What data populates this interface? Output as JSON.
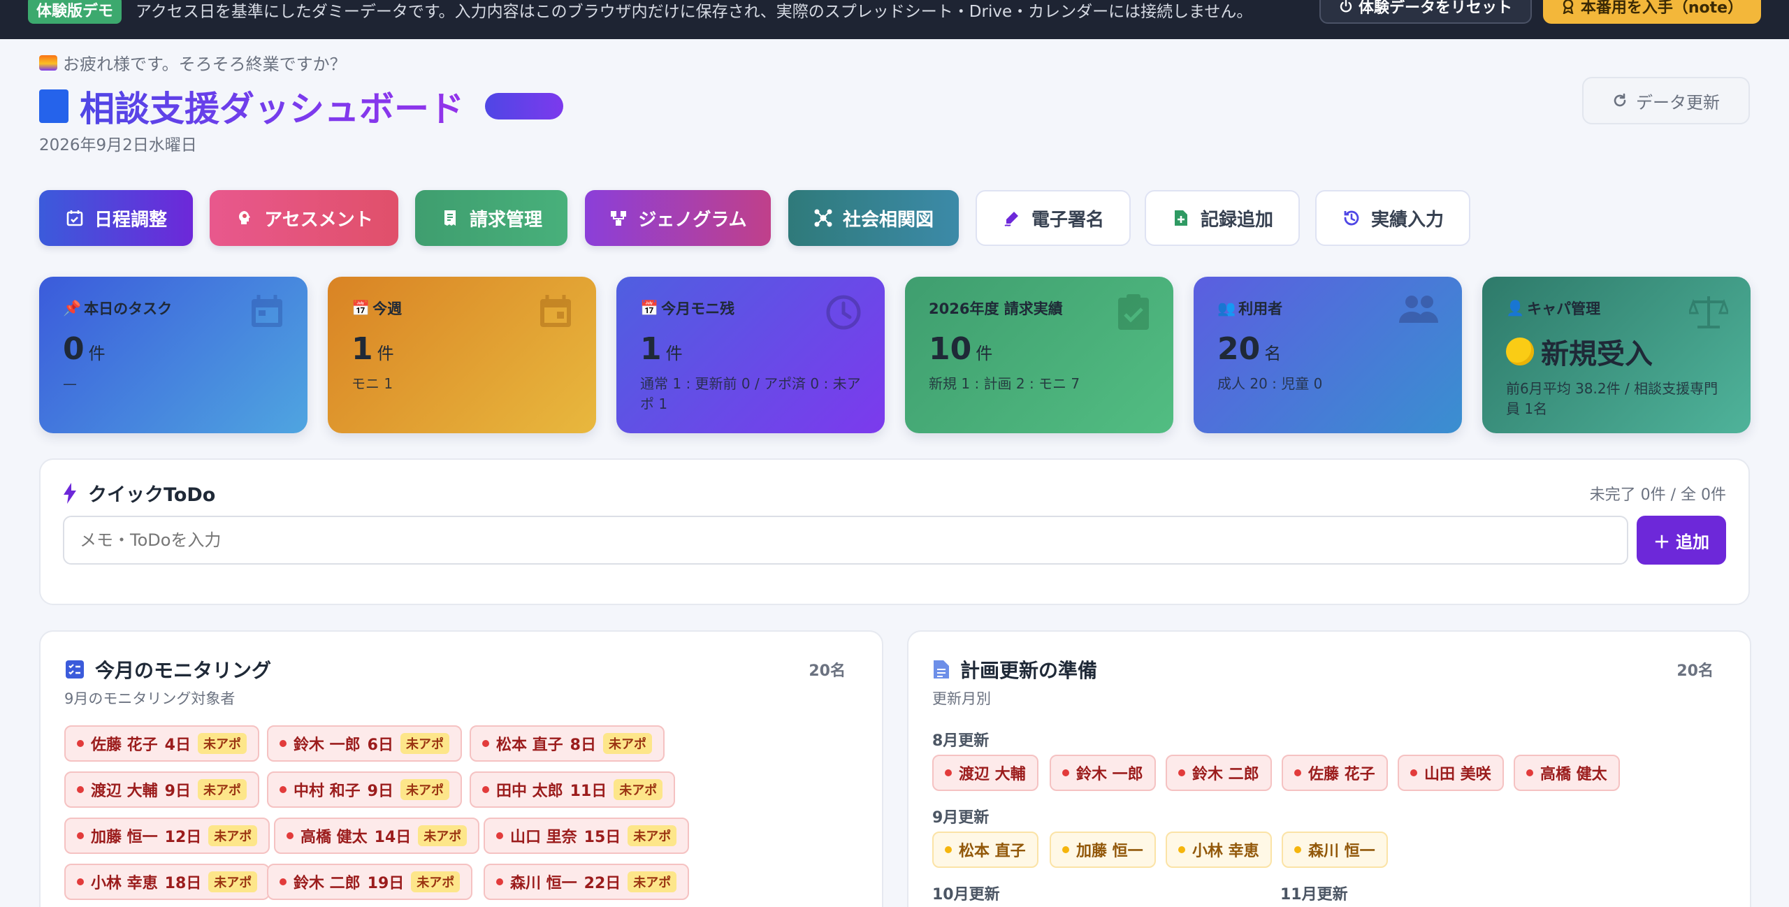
{
  "demo_bar": {
    "tag": "体験版デモ",
    "text": "アクセス日を基準にしたダミーデータです。入力内容はこのブラウザ内だけに保存され、実際のスプレッドシート・Drive・カレンダーには接続しません。",
    "reset_label": "体験データをリセット",
    "get_label": "本番用を入手（note）"
  },
  "header": {
    "greeting": "お疲れ様です。そろそろ終業ですか？",
    "title": "相談支援ダッシュボード",
    "date": "2026年9月2日水曜日",
    "refresh_label": "データ更新"
  },
  "actions": [
    {
      "label": "日程調整",
      "icon": "calendar-check-icon"
    },
    {
      "label": "アセスメント",
      "icon": "head-bulb-icon"
    },
    {
      "label": "請求管理",
      "icon": "receipt-icon"
    },
    {
      "label": "ジェノグラム",
      "icon": "genogram-icon"
    },
    {
      "label": "社会相関図",
      "icon": "network-icon"
    },
    {
      "label": "電子署名",
      "icon": "signature-pen-icon"
    },
    {
      "label": "記録追加",
      "icon": "file-plus-icon"
    },
    {
      "label": "実績入力",
      "icon": "history-icon"
    }
  ],
  "stats": [
    {
      "label": "本日のタスク",
      "value": "0",
      "unit": "件",
      "sub": "—",
      "icon": "pin-icon",
      "watermark": "calendar-icon"
    },
    {
      "label": "今週",
      "value": "1",
      "unit": "件",
      "sub": "モニ 1",
      "icon": "calendar-small-icon",
      "watermark": "calendar-icon"
    },
    {
      "label": "今月モニ残",
      "value": "1",
      "unit": "件",
      "sub": "通常 1 : 更新前 0 / アポ済 0 : 未アポ 1",
      "icon": "calendar-small-icon",
      "watermark": "clock-icon"
    },
    {
      "label": "2026年度 請求実績",
      "value": "10",
      "unit": "件",
      "sub": "新規 1 : 計画 2 : モニ 7",
      "icon": "",
      "watermark": "clipboard-check-icon"
    },
    {
      "label": "利用者",
      "value": "20",
      "unit": "名",
      "sub": "成人 20 : 児童 0",
      "icon": "people-icon",
      "watermark": "people-icon"
    },
    {
      "label": "キャパ管理",
      "value": "新規受入",
      "unit": "",
      "sub": "前6月平均 38.2件 / 相談支援専門員 1名",
      "icon": "person-icon",
      "watermark": "scale-icon"
    }
  ],
  "todo": {
    "title": "クイックToDo",
    "count": "未完了 0件 / 全 0件",
    "placeholder": "メモ・ToDoを入力",
    "add_label": "追加"
  },
  "monitoring": {
    "title": "今月のモニタリング",
    "subtitle": "9月のモニタリング対象者",
    "count": "20名",
    "badge": "未アポ",
    "items": [
      {
        "name": "佐藤 花子",
        "day": "4日"
      },
      {
        "name": "鈴木 一郎",
        "day": "6日"
      },
      {
        "name": "松本 直子",
        "day": "8日"
      },
      {
        "name": "渡辺 大輔",
        "day": "9日"
      },
      {
        "name": "中村 和子",
        "day": "9日"
      },
      {
        "name": "田中 太郎",
        "day": "11日"
      },
      {
        "name": "加藤 恒一",
        "day": "12日"
      },
      {
        "name": "高橋 健太",
        "day": "14日"
      },
      {
        "name": "山口 里奈",
        "day": "15日"
      },
      {
        "name": "小林 幸恵",
        "day": "18日"
      },
      {
        "name": "鈴木 二郎",
        "day": "19日"
      },
      {
        "name": "森川 恒一",
        "day": "22日"
      }
    ]
  },
  "plan_update": {
    "title": "計画更新の準備",
    "subtitle": "更新月別",
    "count": "20名",
    "groups": [
      {
        "label": "8月更新",
        "names": [
          "渡辺 大輔",
          "鈴木 一郎",
          "鈴木 二郎",
          "佐藤 花子",
          "山田 美咲",
          "高橋 健太"
        ]
      },
      {
        "label": "9月更新",
        "names": [
          "松本 直子",
          "加藤 恒一",
          "小林 幸恵",
          "森川 恒一"
        ]
      },
      {
        "label": "10月更新",
        "names": []
      },
      {
        "label": "11月更新",
        "names": []
      }
    ]
  }
}
